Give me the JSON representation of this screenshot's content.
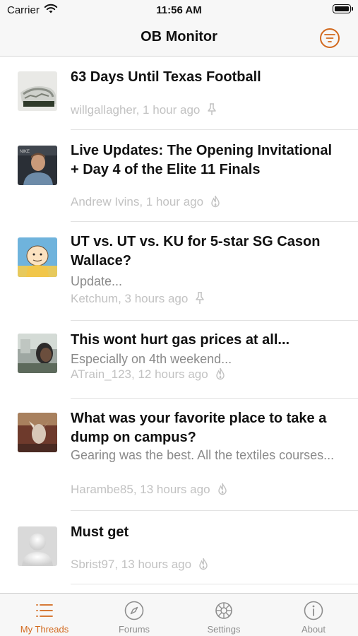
{
  "status_bar": {
    "carrier": "Carrier",
    "time": "11:56 AM"
  },
  "nav": {
    "title": "OB Monitor",
    "filter_icon": "filter-list-icon"
  },
  "colors": {
    "accent": "#d2691e",
    "meta": "#c2c2c2",
    "preview": "#8a8a8a"
  },
  "threads": [
    {
      "title": "63 Days Until Texas Football",
      "preview": "",
      "author_time": "willgallagher, 1 hour ago",
      "status_icon": "pin-icon"
    },
    {
      "title": "Live Updates: The Opening Invitational + Day 4 of the Elite 11 Finals",
      "preview": "",
      "author_time": "Andrew Ivins, 1 hour ago",
      "status_icon": "flame-icon"
    },
    {
      "title": "UT vs. UT vs. KU for 5-star SG Cason Wallace?",
      "preview": "Update...",
      "author_time": "Ketchum, 3 hours ago",
      "status_icon": "pin-icon"
    },
    {
      "title": "This wont hurt gas prices at all...",
      "preview": "Especially on 4th weekend...",
      "author_time": "ATrain_123, 12 hours ago",
      "status_icon": "flame-icon"
    },
    {
      "title": "What was your favorite place to take a dump on campus?",
      "preview": "Gearing was the best. All the textiles courses...",
      "author_time": "Harambe85, 13 hours ago",
      "status_icon": "flame-icon"
    },
    {
      "title": "Must get",
      "preview": "",
      "author_time": "Sbrist97, 13 hours ago",
      "status_icon": "flame-icon"
    }
  ],
  "tabs": [
    {
      "label": "My Threads",
      "icon": "list-icon",
      "active": true
    },
    {
      "label": "Forums",
      "icon": "compass-icon",
      "active": false
    },
    {
      "label": "Settings",
      "icon": "gear-icon",
      "active": false
    },
    {
      "label": "About",
      "icon": "info-icon",
      "active": false
    }
  ]
}
